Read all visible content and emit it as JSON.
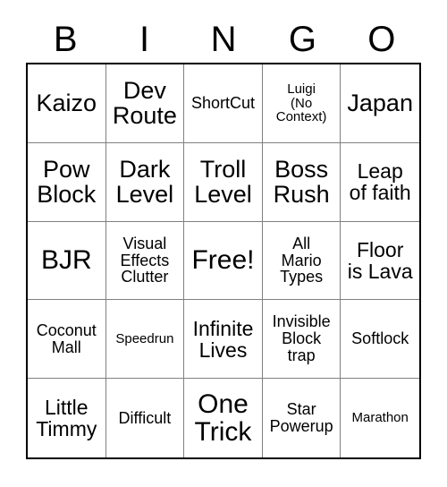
{
  "header": {
    "letters": [
      "B",
      "I",
      "N",
      "G",
      "O"
    ]
  },
  "grid": {
    "rows": 5,
    "columns": 5,
    "border_color": "#000000",
    "grid_line_color": "#808080",
    "background_color": "#ffffff",
    "text_color": "#000000",
    "cells": [
      {
        "text": "Kaizo",
        "size": "lg"
      },
      {
        "text": "Dev\nRoute",
        "size": "lg"
      },
      {
        "text": "ShortCut",
        "size": "sm"
      },
      {
        "text": "Luigi\n(No\nContext)",
        "size": "xs"
      },
      {
        "text": "Japan",
        "size": "lg"
      },
      {
        "text": "Pow\nBlock",
        "size": "lg"
      },
      {
        "text": "Dark\nLevel",
        "size": "lg"
      },
      {
        "text": "Troll\nLevel",
        "size": "lg"
      },
      {
        "text": "Boss\nRush",
        "size": "lg"
      },
      {
        "text": "Leap\nof faith",
        "size": "md"
      },
      {
        "text": "BJR",
        "size": "xl"
      },
      {
        "text": "Visual\nEffects\nClutter",
        "size": "sm"
      },
      {
        "text": "Free!",
        "size": "xl"
      },
      {
        "text": "All\nMario\nTypes",
        "size": "sm"
      },
      {
        "text": "Floor\nis Lava",
        "size": "md"
      },
      {
        "text": "Coconut\nMall",
        "size": "sm"
      },
      {
        "text": "Speedrun",
        "size": "xs"
      },
      {
        "text": "Infinite\nLives",
        "size": "md"
      },
      {
        "text": "Invisible\nBlock\ntrap",
        "size": "sm"
      },
      {
        "text": "Softlock",
        "size": "sm"
      },
      {
        "text": "Little\nTimmy",
        "size": "md"
      },
      {
        "text": "Difficult",
        "size": "sm"
      },
      {
        "text": "One\nTrick",
        "size": "xl"
      },
      {
        "text": "Star\nPowerup",
        "size": "sm"
      },
      {
        "text": "Marathon",
        "size": "xs"
      }
    ]
  }
}
